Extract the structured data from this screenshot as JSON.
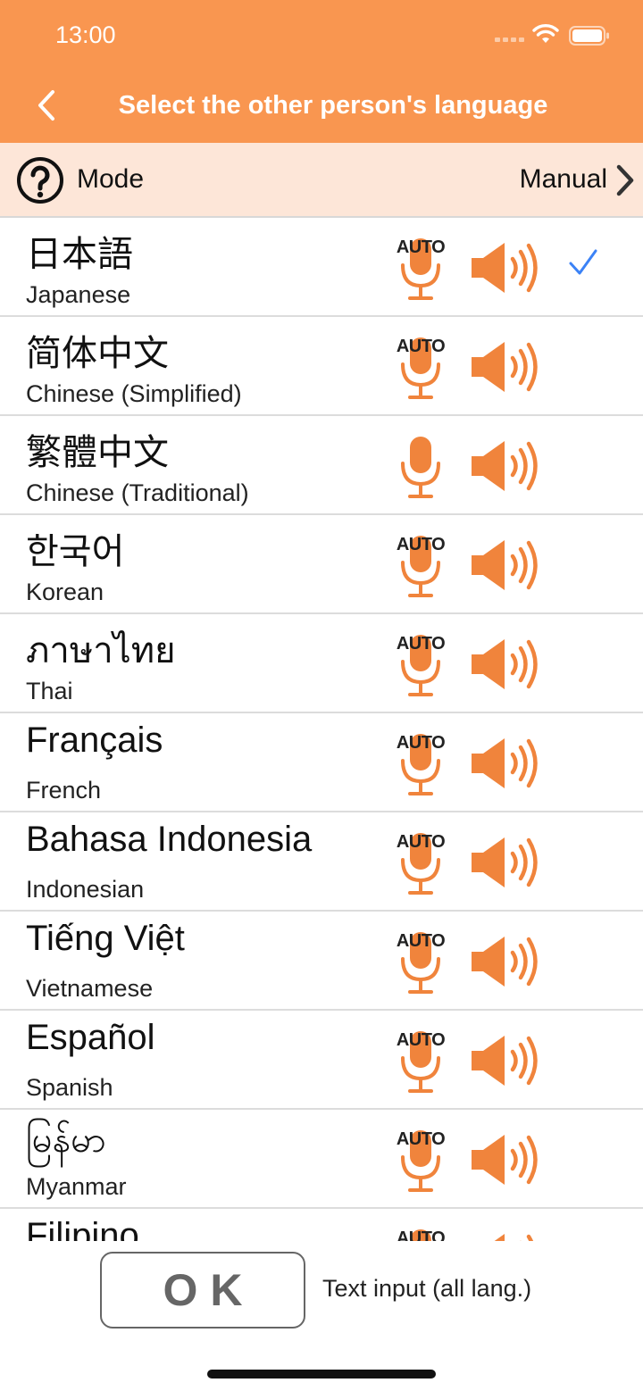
{
  "status": {
    "time": "13:00"
  },
  "header": {
    "title": "Select the other person's language"
  },
  "mode": {
    "label": "Mode",
    "value": "Manual"
  },
  "languages": [
    {
      "native": "日本語",
      "english": "Japanese",
      "auto": "AUTO",
      "selected": true
    },
    {
      "native": "简体中文",
      "english": "Chinese (Simplified)",
      "auto": "AUTO",
      "selected": false
    },
    {
      "native": "繁體中文",
      "english": "Chinese (Traditional)",
      "auto": "",
      "selected": false
    },
    {
      "native": "한국어",
      "english": "Korean",
      "auto": "AUTO",
      "selected": false
    },
    {
      "native": "ภาษาไทย",
      "english": "Thai",
      "auto": "AUTO",
      "selected": false
    },
    {
      "native": "Français",
      "english": "French",
      "auto": "AUTO",
      "selected": false
    },
    {
      "native": "Bahasa Indonesia",
      "english": "Indonesian",
      "auto": "AUTO",
      "selected": false
    },
    {
      "native": "Tiếng Việt",
      "english": "Vietnamese",
      "auto": "AUTO",
      "selected": false
    },
    {
      "native": "Español",
      "english": "Spanish",
      "auto": "AUTO",
      "selected": false
    },
    {
      "native": "မြန်မာ",
      "english": "Myanmar",
      "auto": "AUTO",
      "selected": false
    },
    {
      "native": "Filipino",
      "english": "",
      "auto": "AUTO",
      "selected": false
    }
  ],
  "footer": {
    "ok_label": "OK",
    "text_input_label": "Text input (all lang.)"
  },
  "colors": {
    "header": "#f99650",
    "accent": "#f0843c",
    "mode_bar": "#fde6d8",
    "check": "#3b82f6"
  },
  "icons": {
    "back": "chevron-left-icon",
    "help": "question-circle-icon",
    "mode_next": "chevron-right-icon",
    "mic": "microphone-icon",
    "speaker": "speaker-icon",
    "selected": "checkmark-icon"
  }
}
